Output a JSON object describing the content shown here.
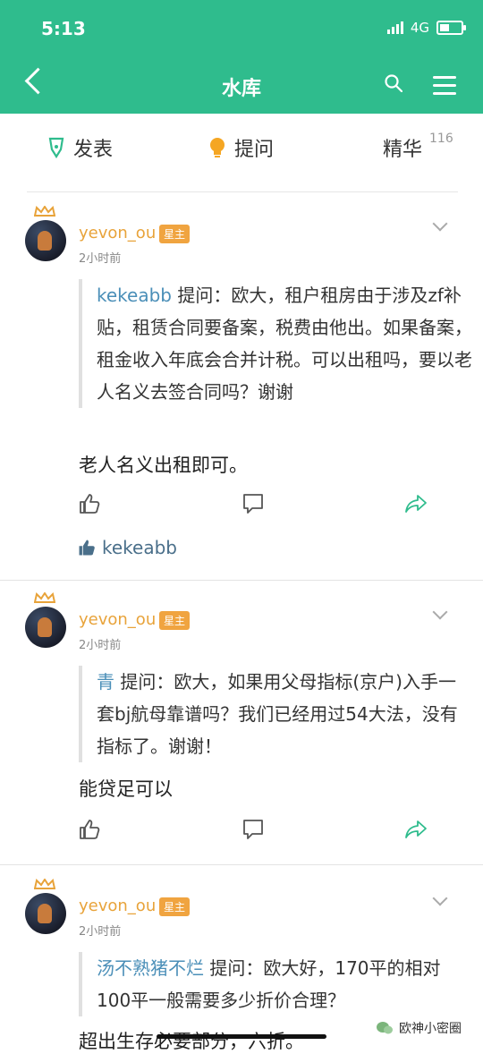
{
  "status": {
    "time": "5:13",
    "network": "4G"
  },
  "header": {
    "title": "水库"
  },
  "tabs": [
    {
      "label": "发表"
    },
    {
      "label": "提问"
    },
    {
      "label": "精华",
      "count": "116"
    }
  ],
  "posts": [
    {
      "username": "yevon_ou",
      "badge": "星主",
      "time": "2小时前",
      "asker": "kekeabb",
      "question_label": "提问：",
      "question": "欧大，租户租房由于涉及zf补贴，租赁合同要备案，税费由他出。如果备案，租金收入年底会合并计税。可以出租吗，要以老人名义去签合同吗？谢谢",
      "answer": "老人名义出租即可。",
      "liked_by": "kekeabb"
    },
    {
      "username": "yevon_ou",
      "badge": "星主",
      "time": "2小时前",
      "asker": "青",
      "question_label": "提问：",
      "question": "欧大，如果用父母指标(京户)入手一套bj航母靠谱吗？我们已经用过54大法，没有指标了。谢谢！",
      "answer": "能贷足可以"
    },
    {
      "username": "yevon_ou",
      "badge": "星主",
      "time": "2小时前",
      "asker": "汤不熟猪不烂",
      "question_label": "提问：",
      "question": "欧大好，170平的相对100平一般需要多少折价合理？",
      "answer": "超出生存必要部分，六折。"
    }
  ],
  "footer": {
    "brand": "欧神小密圈"
  },
  "colors": {
    "primary": "#2fbc8d",
    "username": "#e8a33a",
    "asker": "#4b8fb8"
  }
}
